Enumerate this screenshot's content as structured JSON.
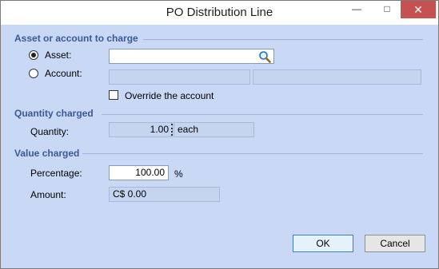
{
  "window": {
    "title": "PO Distribution Line",
    "minimize_icon": "minimize-icon",
    "maximize_icon": "maximize-icon",
    "close_icon": "close-icon"
  },
  "asset_section": {
    "heading": "Asset or account to charge",
    "asset_radio_label": "Asset:",
    "asset_selected": true,
    "asset_value": "",
    "search_icon": "magnifier-icon",
    "account_radio_label": "Account:",
    "account_value_1": "",
    "account_value_2": "",
    "override_label": "Override the account",
    "override_checked": false
  },
  "quantity_section": {
    "heading": "Quantity charged",
    "quantity_label": "Quantity:",
    "quantity_value": "1.00",
    "unit": "each"
  },
  "value_section": {
    "heading": "Value charged",
    "percentage_label": "Percentage:",
    "percentage_value": "100.00",
    "percent_symbol": "%",
    "amount_label": "Amount:",
    "amount_value": "C$ 0.00"
  },
  "buttons": {
    "ok_label": "OK",
    "cancel_label": "Cancel"
  }
}
